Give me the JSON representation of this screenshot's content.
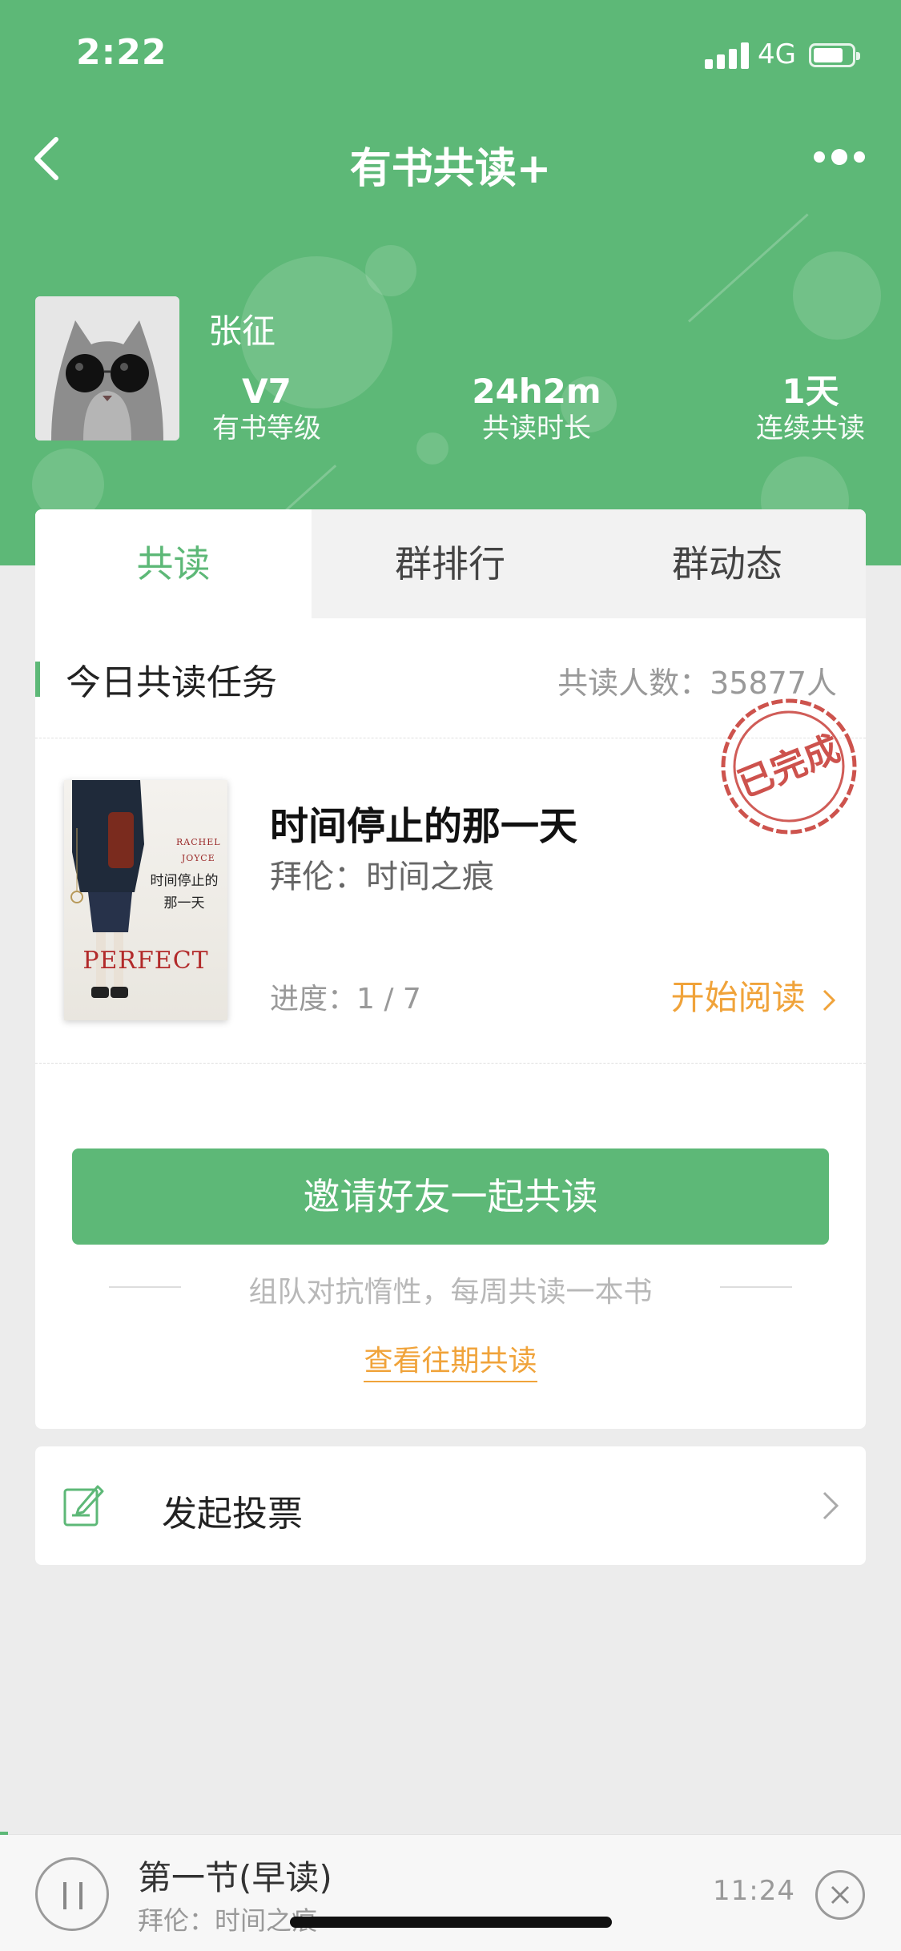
{
  "status_bar": {
    "time": "2:22",
    "network": "4G"
  },
  "nav": {
    "title": "有书共读+"
  },
  "profile": {
    "name": "张征",
    "stats": [
      {
        "value": "V7",
        "label": "有书等级"
      },
      {
        "value": "24h2m",
        "label": "共读时长"
      },
      {
        "value": "1天",
        "label": "连续共读"
      }
    ]
  },
  "tabs": [
    {
      "label": "共读",
      "active": true
    },
    {
      "label": "群排行",
      "active": false
    },
    {
      "label": "群动态",
      "active": false
    }
  ],
  "task": {
    "title": "今日共读任务",
    "count_label": "共读人数：35877人",
    "stamp_text": "已完成"
  },
  "book": {
    "title": "时间停止的那一天",
    "subtitle": "拜伦：时间之痕",
    "progress": "进度：1 / 7",
    "action": "开始阅读",
    "cover": {
      "author_line1": "RACHEL",
      "author_line2": "JOYCE",
      "title": "时间停止的那一天",
      "english_title": "PERFECT"
    }
  },
  "invite": {
    "button_label": "邀请好友一起共读",
    "slogan": "组队对抗惰性，每周共读一本书",
    "history_link": "查看往期共读"
  },
  "vote": {
    "label": "发起投票"
  },
  "player": {
    "title": "第一节(早读)",
    "subtitle": "拜伦：时间之痕",
    "time": "11:24"
  },
  "colors": {
    "brand_green": "#5db877",
    "accent_orange": "#f0a33a",
    "stamp_red": "#c8403a"
  }
}
